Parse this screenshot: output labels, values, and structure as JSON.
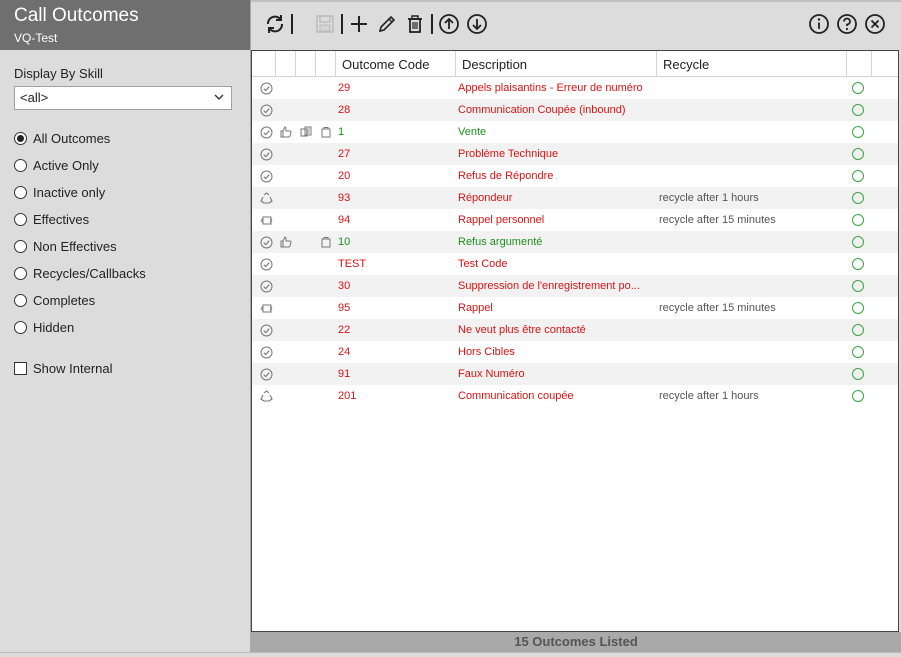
{
  "header": {
    "title": "Call Outcomes",
    "subtitle": "VQ-Test"
  },
  "filters": {
    "skill_label": "Display By Skill",
    "skill_value": "<all>",
    "options": [
      {
        "label": "All Outcomes",
        "selected": true
      },
      {
        "label": "Active Only",
        "selected": false
      },
      {
        "label": "Inactive only",
        "selected": false
      },
      {
        "label": "Effectives",
        "selected": false
      },
      {
        "label": "Non Effectives",
        "selected": false
      },
      {
        "label": "Recycles/Callbacks",
        "selected": false
      },
      {
        "label": "Completes",
        "selected": false
      },
      {
        "label": "Hidden",
        "selected": false
      }
    ],
    "show_internal_label": "Show Internal",
    "show_internal_checked": false
  },
  "columns": {
    "code": "Outcome Code",
    "description": "Description",
    "recycle": "Recycle"
  },
  "rows": [
    {
      "icon": "check",
      "code": "29",
      "description": "Appels plaisantins - Erreur de numéro",
      "recycle": "",
      "color": "red"
    },
    {
      "icon": "check",
      "code": "28",
      "description": "Communication Coupée (inbound)",
      "recycle": "",
      "color": "red"
    },
    {
      "icon": "check",
      "code": "1",
      "description": "Vente",
      "recycle": "",
      "color": "green",
      "extra_icons": [
        "thumb",
        "coins",
        "bag"
      ]
    },
    {
      "icon": "check",
      "code": "27",
      "description": "Problème Technique",
      "recycle": "",
      "color": "red"
    },
    {
      "icon": "check",
      "code": "20",
      "description": "Refus de Répondre",
      "recycle": "",
      "color": "red"
    },
    {
      "icon": "recycle",
      "code": "93",
      "description": "Répondeur",
      "recycle": "recycle after 1 hours",
      "color": "red"
    },
    {
      "icon": "callback",
      "code": "94",
      "description": "Rappel personnel",
      "recycle": "recycle after 15 minutes",
      "color": "red"
    },
    {
      "icon": "check",
      "code": "10",
      "description": "Refus argumenté",
      "recycle": "",
      "color": "green",
      "extra_icons": [
        "thumb",
        "",
        "bag"
      ]
    },
    {
      "icon": "check",
      "code": "TEST",
      "description": "Test Code",
      "recycle": "",
      "color": "red"
    },
    {
      "icon": "check",
      "code": "30",
      "description": "Suppression de l'enregistrement  po...",
      "recycle": "",
      "color": "red"
    },
    {
      "icon": "callback",
      "code": "95",
      "description": "Rappel",
      "recycle": "recycle after 15 minutes",
      "color": "red"
    },
    {
      "icon": "check",
      "code": "22",
      "description": "Ne veut plus être contacté",
      "recycle": "",
      "color": "red"
    },
    {
      "icon": "check",
      "code": "24",
      "description": "Hors Cibles",
      "recycle": "",
      "color": "red"
    },
    {
      "icon": "check",
      "code": "91",
      "description": "Faux Numéro",
      "recycle": "",
      "color": "red"
    },
    {
      "icon": "recycle",
      "code": "201",
      "description": "Communication coupée",
      "recycle": "recycle after 1 hours",
      "color": "red"
    }
  ],
  "footer": {
    "status": "15 Outcomes Listed"
  },
  "colors": {
    "red": "#d81414",
    "green": "#1e8f1e",
    "status_ok": "#3aa640"
  }
}
